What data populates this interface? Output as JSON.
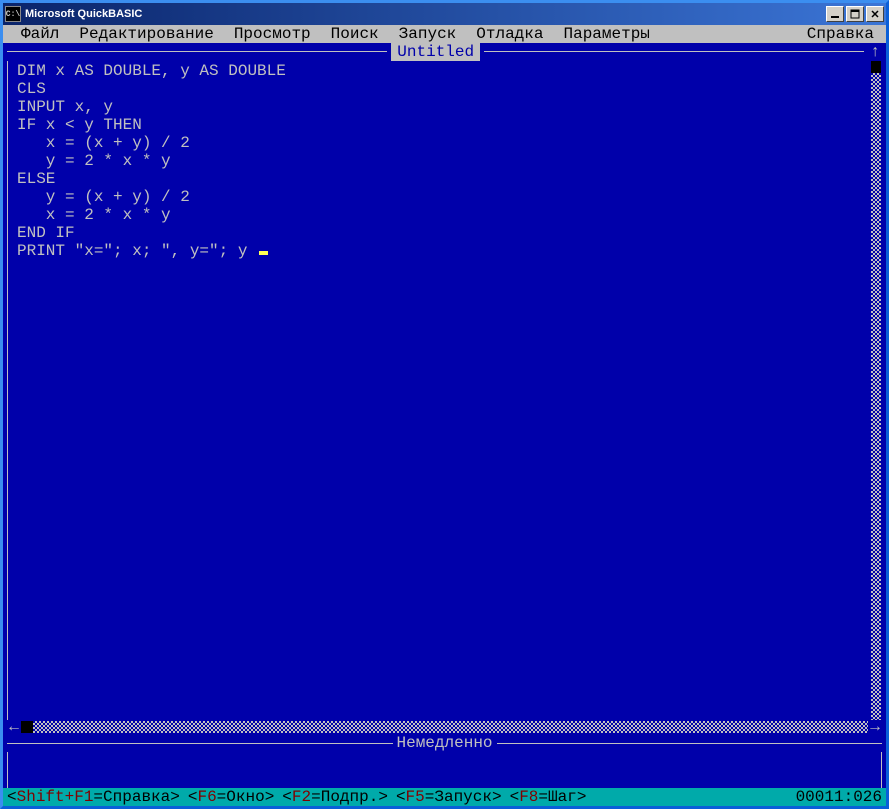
{
  "window": {
    "title": "Microsoft QuickBASIC"
  },
  "menu": {
    "file": "Файл",
    "edit": "Редактирование",
    "view": "Просмотр",
    "search": "Поиск",
    "run": "Запуск",
    "debug": "Отладка",
    "options": "Параметры",
    "help": "Справка"
  },
  "editor": {
    "doc_title": "Untitled",
    "code": "DIM x AS DOUBLE, y AS DOUBLE\nCLS\nINPUT x, y\nIF x < y THEN\n   x = (x + y) / 2\n   y = 2 * x * y\nELSE\n   y = (x + y) / 2\n   x = 2 * x * y\nEND IF\nPRINT \"x=\"; x; \", y=\"; y",
    "immediate_label": "Немедленно"
  },
  "status": {
    "hints": [
      {
        "key": "Shift+F1",
        "label": "Справка"
      },
      {
        "key": "F6",
        "label": "Окно"
      },
      {
        "key": "F2",
        "label": "Подпр."
      },
      {
        "key": "F5",
        "label": "Запуск"
      },
      {
        "key": "F8",
        "label": "Шаг"
      }
    ],
    "position": "00011:026"
  }
}
